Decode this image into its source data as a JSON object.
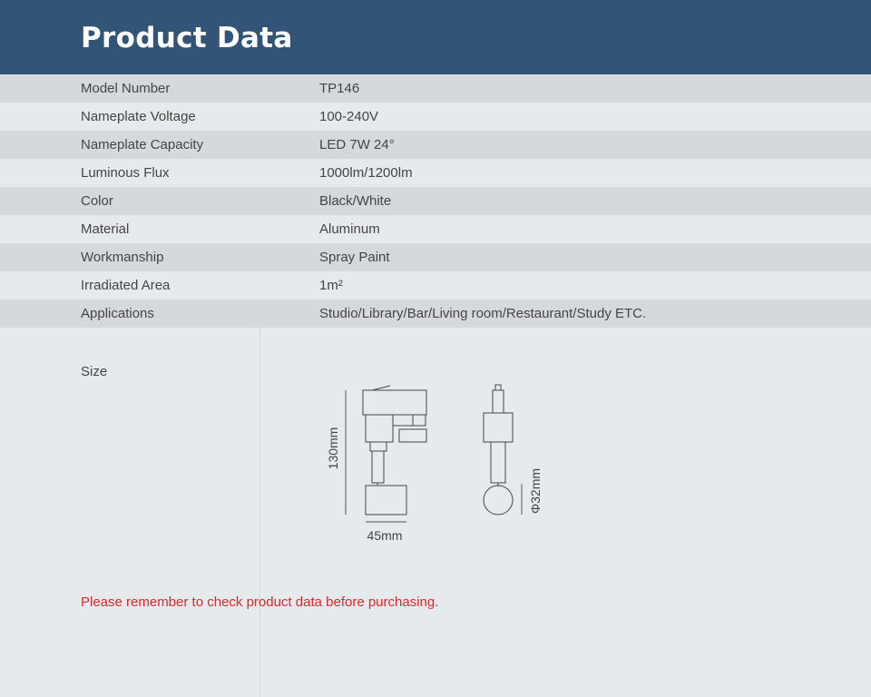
{
  "header": {
    "title": "Product Data"
  },
  "specs": [
    {
      "label": "Model Number",
      "value": "TP146"
    },
    {
      "label": "Nameplate Voltage",
      "value": "100-240V"
    },
    {
      "label": "Nameplate Capacity",
      "value": "LED 7W 24°"
    },
    {
      "label": "Luminous Flux",
      "value": "1000lm/1200lm"
    },
    {
      "label": "Color",
      "value": "Black/White"
    },
    {
      "label": "Material",
      "value": "Aluminum"
    },
    {
      "label": "Workmanship",
      "value": "Spray Paint"
    },
    {
      "label": "Irradiated Area",
      "value": "1m²"
    },
    {
      "label": "Applications",
      "value": "Studio/Library/Bar/Living room/Restaurant/Study ETC."
    }
  ],
  "size": {
    "label": "Size",
    "height": "130mm",
    "width": "45mm",
    "diameter": "Φ32mm"
  },
  "note": "Please remember to check product data before purchasing.",
  "colors": {
    "header_bg": "#325477",
    "note": "#e2262b",
    "row_dark": "#d6d9dc",
    "row_light": "#e7eaec"
  }
}
